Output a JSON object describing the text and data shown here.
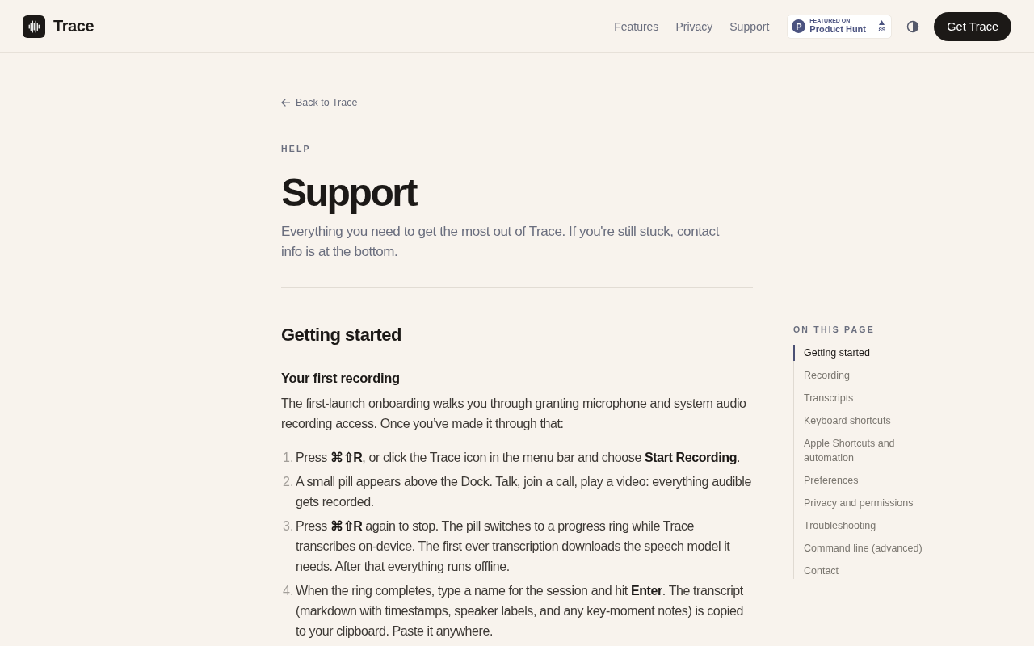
{
  "header": {
    "brand": "Trace",
    "nav": [
      {
        "label": "Features"
      },
      {
        "label": "Privacy"
      },
      {
        "label": "Support"
      }
    ],
    "product_hunt_badge": {
      "logo_letter": "P",
      "eyebrow": "FEATURED ON",
      "name": "Product Hunt",
      "votes": "89"
    },
    "cta": "Get Trace"
  },
  "back_link": "Back to Trace",
  "eyebrow": "HELP",
  "title": "Support",
  "intro": "Everything you need to get the most out of Trace. If you're still stuck, contact info is at the bottom.",
  "section": {
    "heading": "Getting started",
    "subheading": "Your first recording",
    "paragraph": "The first-launch onboarding walks you through granting microphone and system audio recording access. Once you’ve made it through that:",
    "steps": [
      {
        "number": "1.",
        "text": "Press **⌘⇧R**, or click the Trace icon in the menu bar and choose **Start Recording**."
      },
      {
        "number": "2.",
        "text": "A small pill appears above the Dock. Talk, join a call, play a video: everything audible gets recorded."
      },
      {
        "number": "3.",
        "text": "Press **⌘⇧R** again to stop. The pill switches to a progress ring while Trace transcribes on-device. The first ever transcription downloads the speech model it needs. After that everything runs offline."
      },
      {
        "number": "4.",
        "text": "When the ring completes, type a name for the session and hit **Enter**. The transcript (markdown with timestamps, speaker labels, and any key-moment notes) is copied to your clipboard. Paste it anywhere."
      }
    ]
  },
  "toc": {
    "title": "ON THIS PAGE",
    "items": [
      {
        "label": "Getting started",
        "selected": true
      },
      {
        "label": "Recording",
        "selected": false
      },
      {
        "label": "Transcripts",
        "selected": false
      },
      {
        "label": "Keyboard shortcuts",
        "selected": false
      },
      {
        "label": "Apple Shortcuts and automation",
        "selected": false
      },
      {
        "label": "Preferences",
        "selected": false
      },
      {
        "label": "Privacy and permissions",
        "selected": false
      },
      {
        "label": "Troubleshooting",
        "selected": false
      },
      {
        "label": "Command line (advanced)",
        "selected": false
      },
      {
        "label": "Contact",
        "selected": false
      }
    ]
  }
}
